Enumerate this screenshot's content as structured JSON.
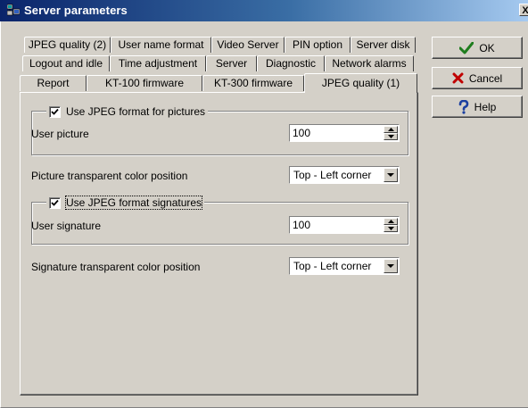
{
  "window": {
    "title": "Server parameters",
    "close_glyph": "X"
  },
  "tabs": {
    "row1": [
      "JPEG quality (2)",
      "User name format",
      "Video Server",
      "PIN option",
      "Server disk"
    ],
    "row2": [
      "Logout and idle",
      "Time adjustment",
      "Server",
      "Diagnostic",
      "Network alarms"
    ],
    "row3": [
      "Report",
      "KT-100 firmware",
      "KT-300 firmware",
      "JPEG quality (1)"
    ],
    "active": "JPEG quality (1)"
  },
  "pictures_group": {
    "checkbox_label": "Use JPEG format for pictures",
    "checked": true,
    "field_label": "User picture",
    "value": "100"
  },
  "picture_transparent": {
    "label": "Picture transparent color position",
    "selected": "Top - Left corner"
  },
  "signatures_group": {
    "checkbox_label": "Use JPEG format signatures",
    "checked": true,
    "field_label": "User signature",
    "value": "100"
  },
  "signature_transparent": {
    "label": "Signature transparent color position",
    "selected": "Top - Left corner"
  },
  "buttons": {
    "ok": "OK",
    "cancel": "Cancel",
    "help": "Help"
  },
  "colors": {
    "face": "#d4d0c8",
    "title_start": "#0a246a",
    "ok_check": "#1e7d1e",
    "cancel_x": "#c00000",
    "help_q": "#1a3fa0"
  },
  "icons": [
    "app-icon",
    "ok-check-icon",
    "cancel-x-icon",
    "help-question-icon",
    "spin-up-icon",
    "spin-down-icon",
    "dropdown-arrow-icon",
    "checkmark-icon"
  ]
}
